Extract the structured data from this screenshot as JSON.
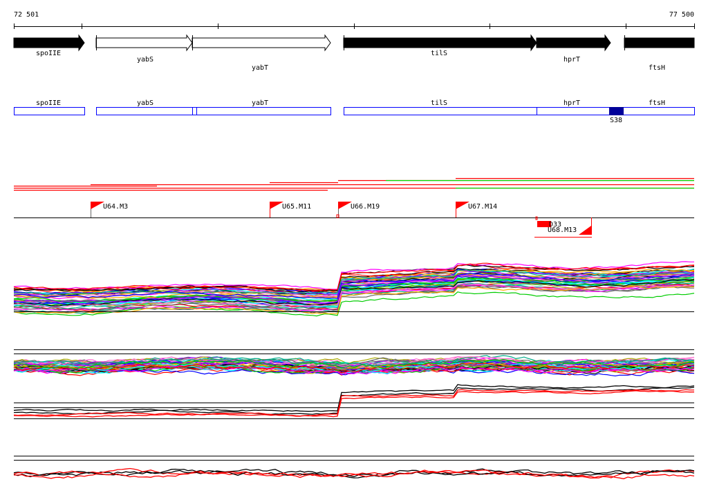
{
  "ruler": {
    "start_label": "72 501",
    "end_label": "77 500"
  },
  "genes": [
    {
      "name": "spoIIE",
      "style": "filled",
      "strand": "+"
    },
    {
      "name": "yabS",
      "style": "open",
      "strand": "+"
    },
    {
      "name": "yabT",
      "style": "open",
      "strand": "+"
    },
    {
      "name": "tilS",
      "style": "filled",
      "strand": "+"
    },
    {
      "name": "hprT",
      "style": "filled",
      "strand": "+"
    },
    {
      "name": "ftsH",
      "style": "filled",
      "strand": "+"
    }
  ],
  "annotation_track": {
    "labels": [
      "spoIIE",
      "yabS",
      "yabT",
      "tilS",
      "hprT",
      "ftsH"
    ],
    "feature": {
      "label": "S38",
      "color": "#000099"
    },
    "box_color": "#0000ff"
  },
  "markers": [
    {
      "label": "U64.M3"
    },
    {
      "label": "U65.M11"
    },
    {
      "label": "U66.M19"
    },
    {
      "label": "U67.M14"
    }
  ],
  "reverse_markers": [
    {
      "label": "D33"
    },
    {
      "label": "U68.M13"
    }
  ],
  "colors": {
    "marker": "#ff0000",
    "segment_alt": "#00dd00",
    "axis": "#000000"
  }
}
